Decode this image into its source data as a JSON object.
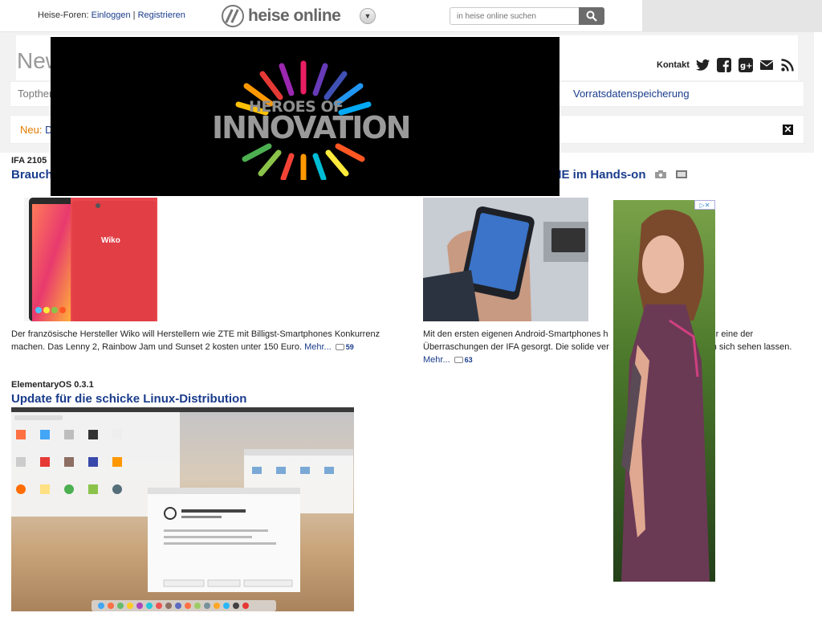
{
  "header": {
    "forum_prefix": "Heise-Foren:",
    "login": "Einloggen",
    "separator": "|",
    "register": "Registrieren",
    "logo_text": "heise online",
    "search_placeholder": "in heise online suchen"
  },
  "masthead": {
    "title_partial": "New",
    "kontakt": "Kontakt",
    "social_icons": [
      "twitter-icon",
      "facebook-icon",
      "google-plus-icon",
      "mail-icon",
      "rss-icon"
    ]
  },
  "nav": {
    "first_partial": "Topther",
    "last": "Vorratsdatenspeicherung"
  },
  "notice": {
    "label": "Neu:",
    "link_partial": "D"
  },
  "video": {
    "line1": "HEROES OF",
    "line2": "INNOVATION"
  },
  "articles": [
    {
      "kicker": "IFA 2105",
      "headline_partial": "Brauch",
      "teaser": "Der französische Hersteller Wiko will Herstellern wie ZTE mit Billigst-Smartphones Konkurrenz machen. Das Lenny 2, Rainbow Jam und Sunset 2 kosten unter 150 Euro.",
      "more": "Mehr...",
      "comments": "59"
    },
    {
      "headline_partial": "ME im Hands-on",
      "teaser_line1": "Mit den ersten eigenen Android-Smartphones h",
      "teaser_line1_end": "ür eine der",
      "teaser_line2": "Überraschungen der IFA gesorgt. Die solide ver",
      "teaser_line2_end": "n sich sehen lassen.",
      "more": "Mehr...",
      "comments": "63"
    },
    {
      "kicker": "ElementaryOS 0.3.1",
      "headline": "Update für die schicke Linux-Distribution"
    }
  ],
  "ad": {
    "badge": "▷✕"
  },
  "colors": {
    "link": "#1a3c8c",
    "accent_orange": "#e07b00"
  }
}
